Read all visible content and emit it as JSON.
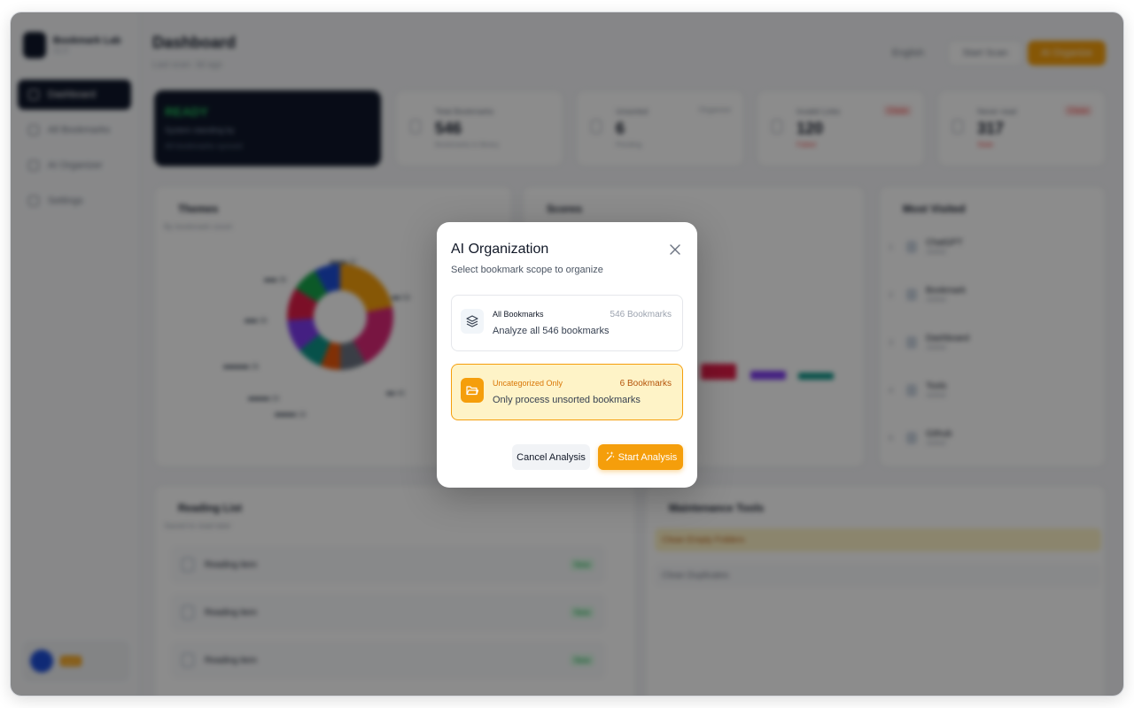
{
  "modal": {
    "title": "AI Organization",
    "subtitle": "Select bookmark scope to organize",
    "options": [
      {
        "title": "All Bookmarks",
        "description": "Analyze all 546 bookmarks",
        "count": "546 Bookmarks",
        "icon": "layers-icon"
      },
      {
        "title": "Uncategorized Only",
        "description": "Only process unsorted bookmarks",
        "count": "6 Bookmarks",
        "icon": "folder-open-icon",
        "selected": true
      }
    ],
    "cancel_label": "Cancel Analysis",
    "start_label": "Start Analysis",
    "close_icon": "close-icon",
    "accent_color": "#f59e0b"
  },
  "background": {
    "sidebar": {
      "brand_name": "Bookmark Lab",
      "brand_sub": "v1.0",
      "items": [
        {
          "label": "Dashboard",
          "active": true
        },
        {
          "label": "All Bookmarks"
        },
        {
          "label": "AI Organizer"
        },
        {
          "label": "Settings"
        }
      ],
      "user_badge": "Lv.1"
    },
    "header": {
      "title": "Dashboard",
      "subtitle": "Last scan: 3d ago",
      "english_label": "English",
      "scan_label": "Start Scan",
      "organize_label": "AI Organize"
    },
    "ready_card": {
      "title": "READY",
      "sub": "System standing by",
      "sub2": "All bookmarks synced"
    },
    "stats": [
      {
        "label": "Total Bookmarks",
        "value": "546",
        "foot": "Bookmarks in library"
      },
      {
        "label": "Unsorted",
        "value": "6",
        "tag": "Organize",
        "foot": "Pending"
      },
      {
        "label": "Invalid Links",
        "value": "120",
        "tag": "Clean",
        "foot": "Failed"
      },
      {
        "label": "Never read",
        "value": "317",
        "tag": "Clean",
        "foot": "Stale"
      }
    ],
    "themes_title": "Themes",
    "themes_sub": "By bookmark count",
    "scores_title": "Scores",
    "most_visited_title": "Most Visited",
    "most_visited_sub": "Last 30 days",
    "most_visited": [
      {
        "rank": "1",
        "title": "ChatGPT",
        "sub": "visited"
      },
      {
        "rank": "2",
        "title": "Bookmark",
        "sub": "visited"
      },
      {
        "rank": "3",
        "title": "Dashboard",
        "sub": "visited"
      },
      {
        "rank": "4",
        "title": "Tools",
        "sub": "visited"
      },
      {
        "rank": "5",
        "title": "Github",
        "sub": "visited"
      }
    ],
    "reading_title": "Reading List",
    "reading_sub": "Saved to read later",
    "reading_items": [
      {
        "title": "Reading item",
        "sub": "saved",
        "tag": "New"
      },
      {
        "title": "Reading item",
        "sub": "saved",
        "tag": "New"
      },
      {
        "title": "Reading item",
        "sub": "saved",
        "tag": "New"
      }
    ],
    "maintenance_title": "Maintenance Tools",
    "maintenance_items": [
      {
        "label": "Clean Empty Folders"
      },
      {
        "label": "Clean Duplicates"
      }
    ],
    "chart_data": {
      "type": "pie",
      "labels": [
        "Theme A",
        "Theme B",
        "Theme C",
        "Theme D",
        "Theme E",
        "Theme F",
        "Theme G",
        "Theme H",
        "Theme I"
      ],
      "values": [
        22,
        20,
        8,
        6,
        8,
        10,
        10,
        8,
        8
      ]
    }
  }
}
